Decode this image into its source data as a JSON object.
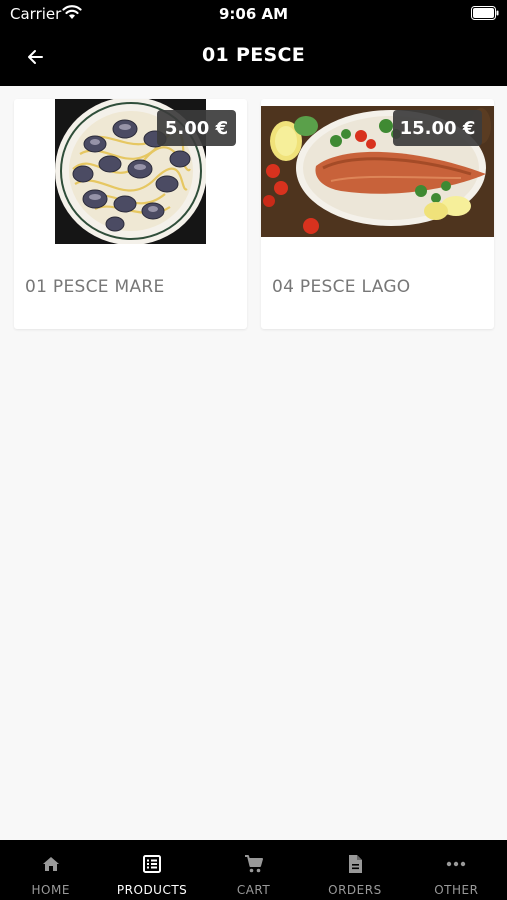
{
  "status_bar": {
    "carrier": "Carrier",
    "time": "9:06 AM",
    "icons": [
      "wifi-icon",
      "battery-icon"
    ]
  },
  "header": {
    "title": "01 PESCE",
    "back_icon": "arrow-left-icon"
  },
  "products": [
    {
      "name": "01 PESCE MARE",
      "price": "5.00 €",
      "image": "spaghetti-with-clams-photo"
    },
    {
      "name": "04 PESCE LAGO",
      "price": "15.00 €",
      "image": "grilled-fish-fillet-photo"
    }
  ],
  "bottom_nav": {
    "items": [
      {
        "label": "HOME",
        "icon": "home-icon",
        "active": false
      },
      {
        "label": "PRODUCTS",
        "icon": "list-icon",
        "active": true
      },
      {
        "label": "CART",
        "icon": "cart-icon",
        "active": false
      },
      {
        "label": "ORDERS",
        "icon": "document-icon",
        "active": false
      },
      {
        "label": "OTHER",
        "icon": "more-icon",
        "active": false
      }
    ]
  },
  "colors": {
    "bar_background": "#000000",
    "page_background": "#f8f8f8",
    "card_background": "#ffffff",
    "badge_background": "#3c3c3c",
    "product_name_text": "#777777",
    "nav_active": "#ffffff",
    "nav_inactive": "#999999"
  }
}
